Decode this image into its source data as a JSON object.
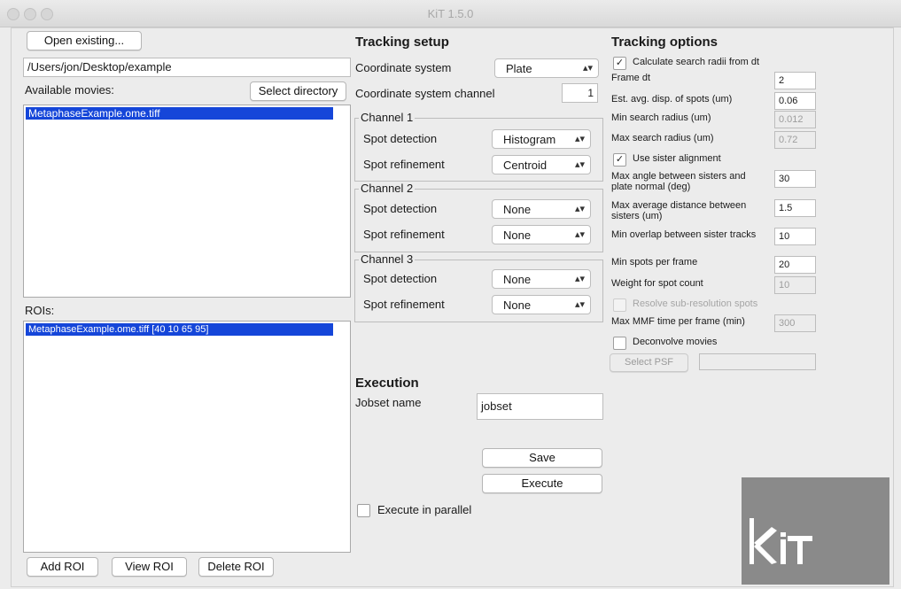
{
  "window": {
    "title": "KiT 1.5.0"
  },
  "left": {
    "open_existing_label": "Open existing...",
    "path_value": "/Users/jon/Desktop/example",
    "available_movies_label": "Available movies:",
    "select_directory_label": "Select directory",
    "movies": [
      "MetaphaseExample.ome.tiff"
    ],
    "rois_label": "ROIs:",
    "rois": [
      "MetaphaseExample.ome.tiff [40 10 65 95]"
    ],
    "add_roi_label": "Add ROI",
    "view_roi_label": "View ROI",
    "delete_roi_label": "Delete ROI"
  },
  "setup": {
    "heading": "Tracking setup",
    "coord_system_label": "Coordinate system",
    "coord_system_value": "Plate",
    "coord_channel_label": "Coordinate system channel",
    "coord_channel_value": "1",
    "channels": [
      {
        "title": "Channel 1",
        "spot_detection_label": "Spot detection",
        "spot_detection_value": "Histogram",
        "spot_refinement_label": "Spot refinement",
        "spot_refinement_value": "Centroid"
      },
      {
        "title": "Channel 2",
        "spot_detection_label": "Spot detection",
        "spot_detection_value": "None",
        "spot_refinement_label": "Spot refinement",
        "spot_refinement_value": "None"
      },
      {
        "title": "Channel 3",
        "spot_detection_label": "Spot detection",
        "spot_detection_value": "None",
        "spot_refinement_label": "Spot refinement",
        "spot_refinement_value": "None"
      }
    ]
  },
  "execution": {
    "heading": "Execution",
    "jobset_label": "Jobset name",
    "jobset_value": "jobset",
    "save_label": "Save",
    "execute_label": "Execute",
    "parallel_label": "Execute in parallel",
    "parallel_checked": false
  },
  "options": {
    "heading": "Tracking options",
    "calc_radii_label": "Calculate search radii from dt",
    "calc_radii_checked": true,
    "frame_dt_label": "Frame dt",
    "frame_dt_value": "2",
    "avg_disp_label": "Est. avg. disp. of spots (um)",
    "avg_disp_value": "0.06",
    "min_radius_label": "Min search radius (um)",
    "min_radius_value": "0.012",
    "max_radius_label": "Max search radius (um)",
    "max_radius_value": "0.72",
    "sister_align_label": "Use sister alignment",
    "sister_align_checked": true,
    "max_angle_label": "Max angle between sisters and plate normal (deg)",
    "max_angle_value": "30",
    "max_avg_dist_label": "Max average distance between sisters (um)",
    "max_avg_dist_value": "1.5",
    "min_overlap_label": "Min overlap between sister tracks",
    "min_overlap_value": "10",
    "min_spots_label": "Min spots per frame",
    "min_spots_value": "20",
    "weight_label": "Weight for spot count",
    "weight_value": "10",
    "resolve_label": "Resolve sub-resolution spots",
    "max_mmf_label": "Max MMF time per frame (min)",
    "max_mmf_value": "300",
    "deconvolve_label": "Deconvolve movies",
    "select_psf_label": "Select PSF",
    "psf_value": ""
  },
  "logo": {
    "text": "KiT",
    "bg_color": "#8a8a8a"
  }
}
